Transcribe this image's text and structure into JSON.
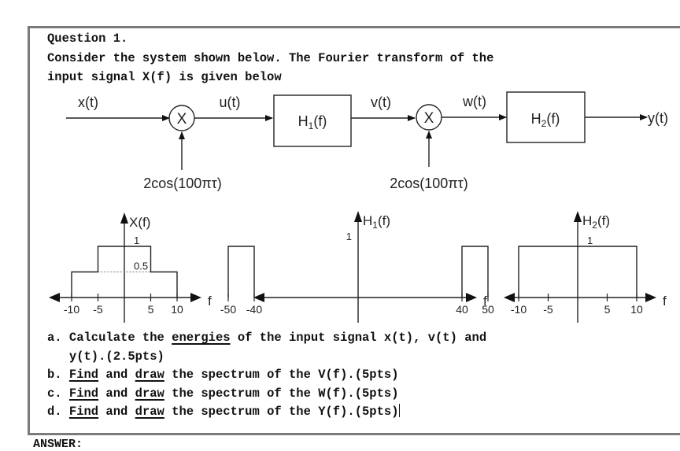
{
  "question": {
    "title": "Question 1.",
    "intro_line1": "Consider the system shown below. The Fourier transform of the",
    "intro_line2": "input signal X(f) is given below"
  },
  "block_diagram": {
    "signals": {
      "input": "x(t)",
      "after_mixer1": "u(t)",
      "after_h1": "v(t)",
      "after_mixer2": "w(t)",
      "output": "y(t)"
    },
    "mixer_symbol": "X",
    "mixer1_input": "2cos(100πτ)",
    "mixer2_input": "2cos(100πτ)",
    "block1": {
      "name": "H",
      "sub": "1",
      "suffix": "(f)"
    },
    "block2": {
      "name": "H",
      "sub": "2",
      "suffix": "(f)"
    }
  },
  "chart_data": [
    {
      "type": "line",
      "title": "X(f)",
      "xlabel": "f",
      "x_ticks": [
        "-10",
        "-5",
        "5",
        "10"
      ],
      "levels": [
        "1",
        "0.5"
      ],
      "segments": [
        {
          "from": -10,
          "to": -5,
          "value": 0.5
        },
        {
          "from": -5,
          "to": 5,
          "value": 1
        },
        {
          "from": 5,
          "to": 10,
          "value": 0.5
        }
      ]
    },
    {
      "type": "line",
      "title": "H1(f)",
      "title_main": "H",
      "title_sub": "1",
      "title_suffix": "(f)",
      "xlabel": "f",
      "x_ticks": [
        "-50",
        "-40",
        "40",
        "50"
      ],
      "levels": [
        "1"
      ],
      "segments": [
        {
          "from": -50,
          "to": -40,
          "value": 1
        },
        {
          "from": 40,
          "to": 50,
          "value": 1
        }
      ]
    },
    {
      "type": "line",
      "title": "H2(f)",
      "title_main": "H",
      "title_sub": "2",
      "title_suffix": "(f)",
      "xlabel": "f",
      "x_ticks": [
        "-10",
        "-5",
        "5",
        "10"
      ],
      "levels": [
        "1"
      ],
      "segments": [
        {
          "from": -10,
          "to": 10,
          "value": 1
        }
      ]
    }
  ],
  "items": [
    {
      "label": "a.",
      "parts": [
        [
          "Calculate the ",
          false
        ],
        [
          "energies",
          true
        ],
        [
          " of the input signal x(t), v(t) and",
          false
        ]
      ],
      "cont": "y(t).(2.5pts)"
    },
    {
      "label": "b.",
      "parts": [
        [
          "Find",
          true
        ],
        [
          " and ",
          false
        ],
        [
          "draw",
          true
        ],
        [
          " the spectrum of the V(f).(5pts)",
          false
        ]
      ]
    },
    {
      "label": "c.",
      "parts": [
        [
          "Find",
          true
        ],
        [
          " and ",
          false
        ],
        [
          "draw",
          true
        ],
        [
          " the spectrum of the W(f).(5pts)",
          false
        ]
      ]
    },
    {
      "label": "d.",
      "parts": [
        [
          "Find",
          true
        ],
        [
          " and ",
          false
        ],
        [
          "draw",
          true
        ],
        [
          " the spectrum of the Y(f).(5pts)",
          false
        ]
      ]
    }
  ],
  "answer_label": "ANSWER:"
}
